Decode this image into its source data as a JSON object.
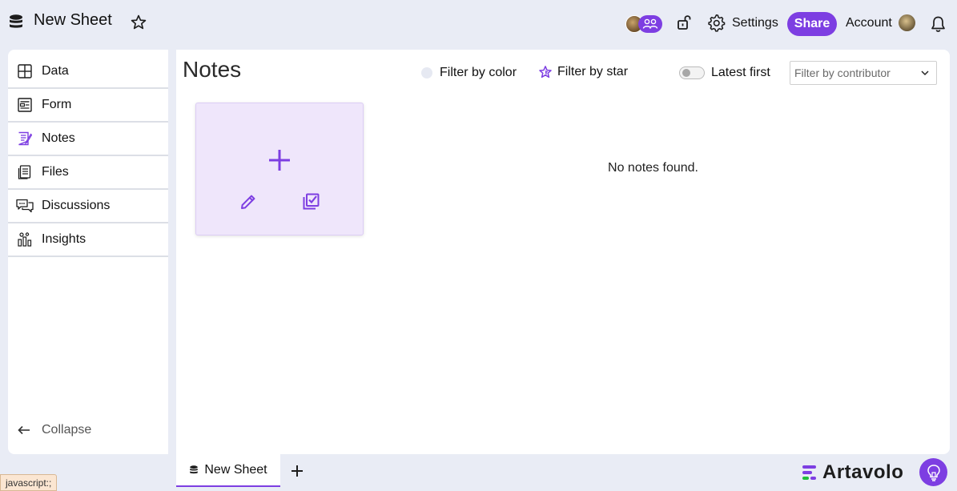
{
  "topbar": {
    "title": "New Sheet",
    "settings_label": "Settings",
    "share_label": "Share",
    "account_label": "Account"
  },
  "sidebar": {
    "items": [
      {
        "label": "Data",
        "icon": "grid-icon"
      },
      {
        "label": "Form",
        "icon": "form-icon"
      },
      {
        "label": "Notes",
        "icon": "notes-icon"
      },
      {
        "label": "Files",
        "icon": "files-icon"
      },
      {
        "label": "Discussions",
        "icon": "discussions-icon"
      },
      {
        "label": "Insights",
        "icon": "insights-icon"
      }
    ],
    "active": "Notes",
    "collapse_label": "Collapse"
  },
  "main": {
    "title": "Notes",
    "filter_color_label": "Filter by color",
    "filter_star_label": "Filter by star",
    "latest_first_label": "Latest first",
    "latest_first_on": false,
    "contributor_placeholder": "Filter by contributor",
    "empty_message": "No notes found."
  },
  "bottom": {
    "tab_label": "New Sheet",
    "brand": "Artavolo",
    "status_link": "javascript:;"
  },
  "colors": {
    "accent": "#7d3ee2",
    "card_bg": "#efe6fb",
    "page_bg": "#e9ecf5"
  }
}
